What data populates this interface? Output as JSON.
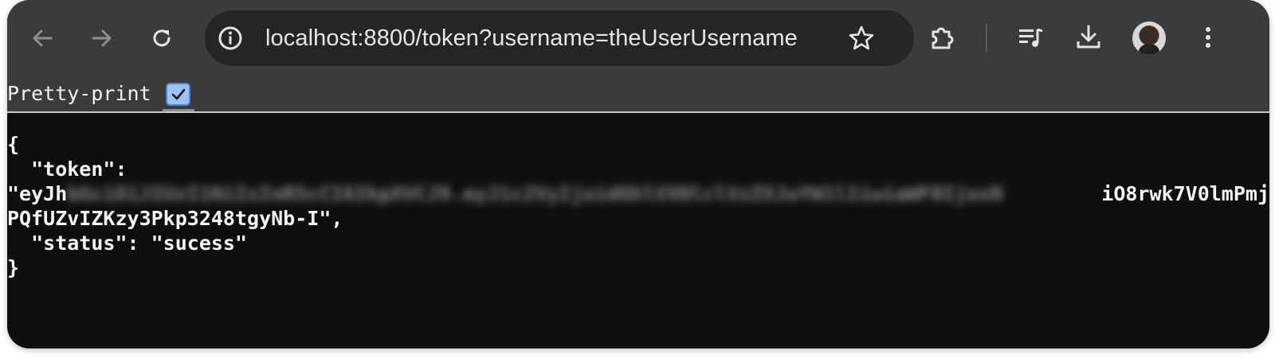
{
  "browser": {
    "url": "localhost:8800/token?username=theUserUsername",
    "icons": {
      "back": "arrow-left-icon",
      "forward": "arrow-right-icon",
      "reload": "reload-icon",
      "site_info": "info-icon",
      "bookmark": "star-icon",
      "extensions": "puzzle-icon",
      "media": "playlist-icon",
      "downloads": "download-icon",
      "profile": "avatar",
      "menu": "kebab-menu-icon"
    }
  },
  "viewer": {
    "pretty_print_label": "Pretty-print",
    "pretty_print_checked": true
  },
  "json": {
    "open_brace": "{",
    "token_key_line": "  \"token\":",
    "token_visible_start": "\"eyJh",
    "token_blurred": "bGciOiJIUzI1NiIsInR5cCI6IkpXVCJ9.eyJ1c2VyIjoidGhlVXNlclVzZXJuYW1lIiwiaWF0IjoxN",
    "token_visible_end": "iO8rwk7V0lmPmj",
    "token_line2": "PQfUZvIZKzy3Pkp3248tgyNb-I\",",
    "status_line": "  \"status\": \"sucess\"",
    "close_brace": "}"
  }
}
